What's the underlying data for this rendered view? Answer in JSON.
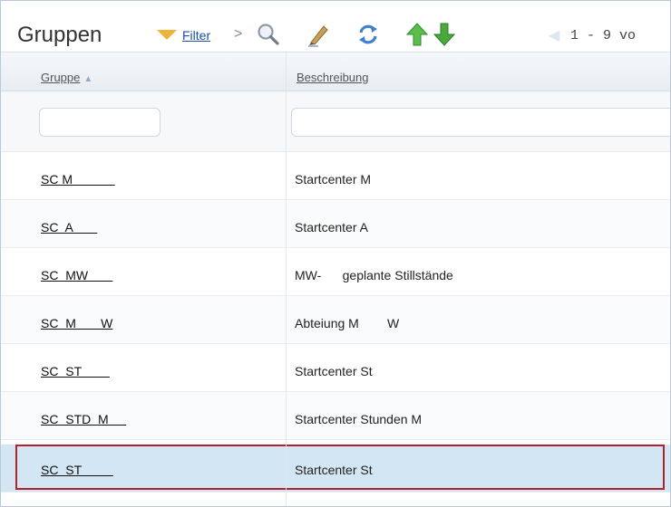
{
  "toolbar": {
    "title": "Gruppen",
    "filter_label": "Filter",
    "chevron": ">",
    "page_info": "1 - 9 vo"
  },
  "columns": {
    "group": "Gruppe",
    "description": "Beschreibung"
  },
  "filters": {
    "group_value": "",
    "description_value": ""
  },
  "rows": [
    {
      "group": "SC M            ",
      "description": "Startcenter M"
    },
    {
      "group": "SC  A       ",
      "description": "Startcenter A"
    },
    {
      "group": "SC  MW       ",
      "description": "MW-      geplante Stillstände"
    },
    {
      "group": "SC  M       W",
      "description": "Abteiung M        W"
    },
    {
      "group": "SC  ST        ",
      "description": "Startcenter St"
    },
    {
      "group": "SC  STD  M     ",
      "description": "Startcenter Stunden M"
    },
    {
      "group": "SC  ST         ",
      "description": "Startcenter St"
    }
  ],
  "colors": {
    "selected_row": "#d3e6f3",
    "selection_border": "#b3222c",
    "link": "#1a4ea8",
    "filter_icon": "#f0b33a",
    "arrow_up": "#3aa23a",
    "arrow_down": "#2c8f2c"
  },
  "icons": [
    "filter-icon",
    "search-icon",
    "pen-icon",
    "refresh-icon",
    "arrow-up-icon",
    "arrow-down-icon",
    "sort-icon"
  ]
}
